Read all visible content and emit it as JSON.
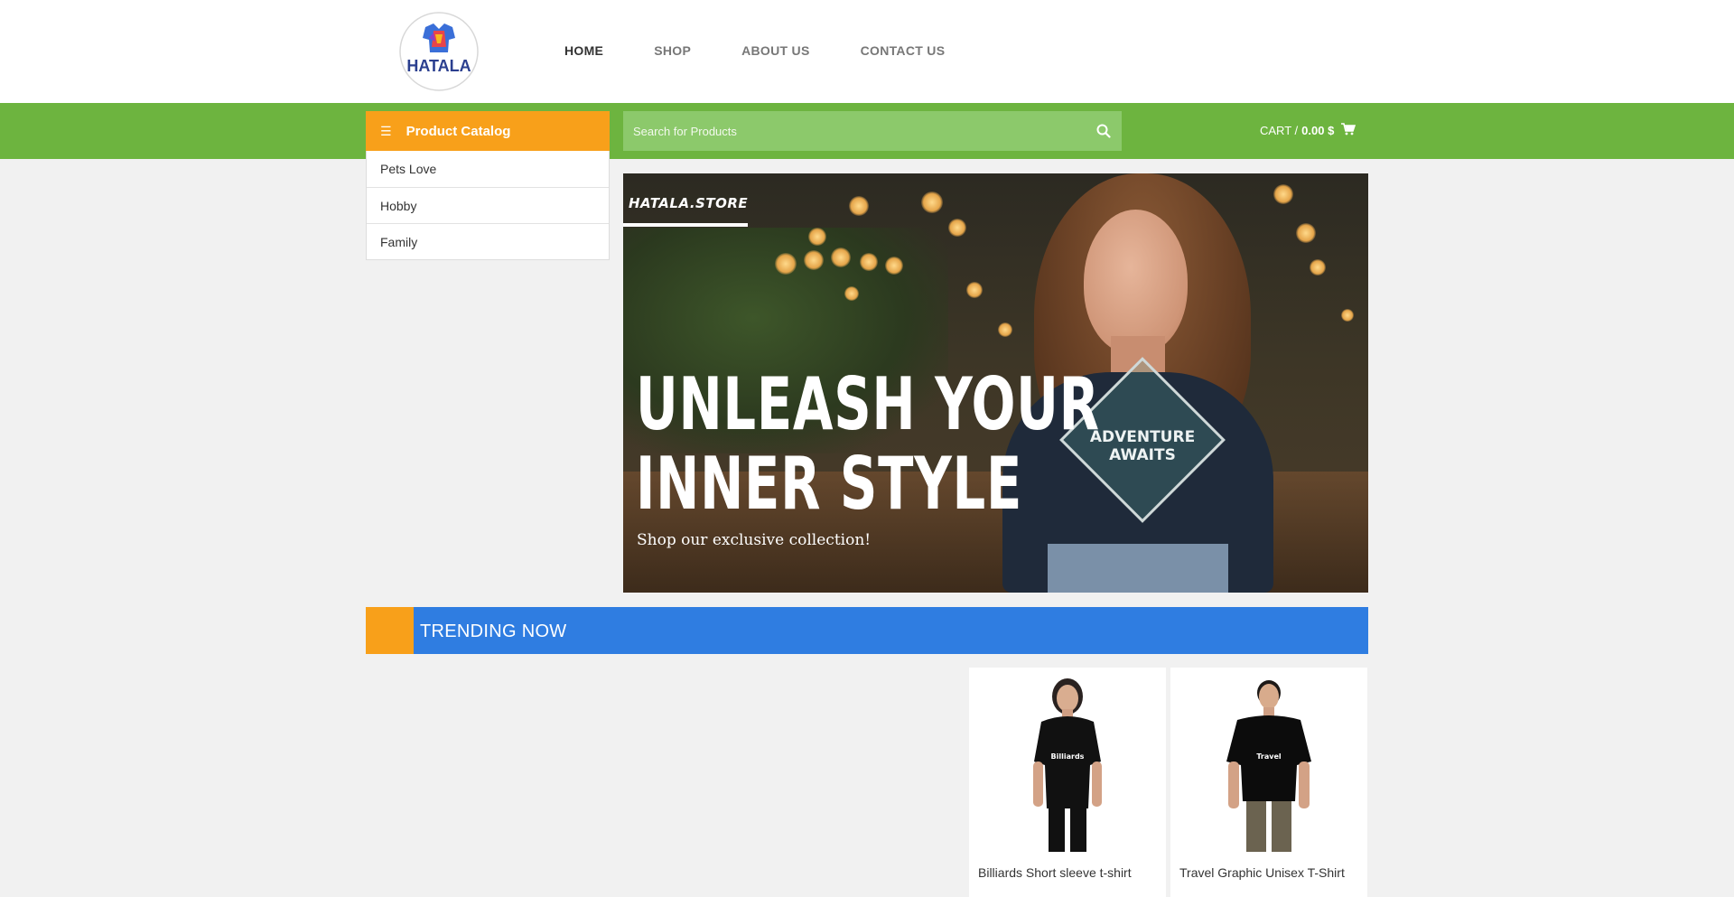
{
  "header": {
    "logo_text": "HATALA",
    "nav": [
      {
        "label": "HOME",
        "active": true
      },
      {
        "label": "SHOP",
        "active": false
      },
      {
        "label": "ABOUT US",
        "active": false
      },
      {
        "label": "CONTACT US",
        "active": false
      }
    ]
  },
  "toolbar": {
    "catalog_label": "Product Catalog",
    "search_placeholder": "Search for Products",
    "cart_label": "CART /",
    "cart_amount": "0.00 $"
  },
  "categories": [
    "Pets Love",
    "Hobby",
    "Family"
  ],
  "banner": {
    "brand": "HATALA.STORE",
    "headline_line1": "UNLEASH YOUR",
    "headline_line2": "INNER STYLE",
    "subtitle": "Shop our exclusive collection!",
    "shirt_line1": "ADVENTURE",
    "shirt_line2": "AWAITS"
  },
  "trending": {
    "title": "TRENDING NOW"
  },
  "products": [
    {
      "name": "Billiards Short sleeve t-shirt",
      "shirt_text": "Billiards"
    },
    {
      "name": "Travel Graphic Unisex T-Shirt",
      "shirt_text": "Travel"
    }
  ],
  "colors": {
    "green": "#6db43f",
    "orange": "#f8a01a",
    "blue": "#2f7de1"
  }
}
